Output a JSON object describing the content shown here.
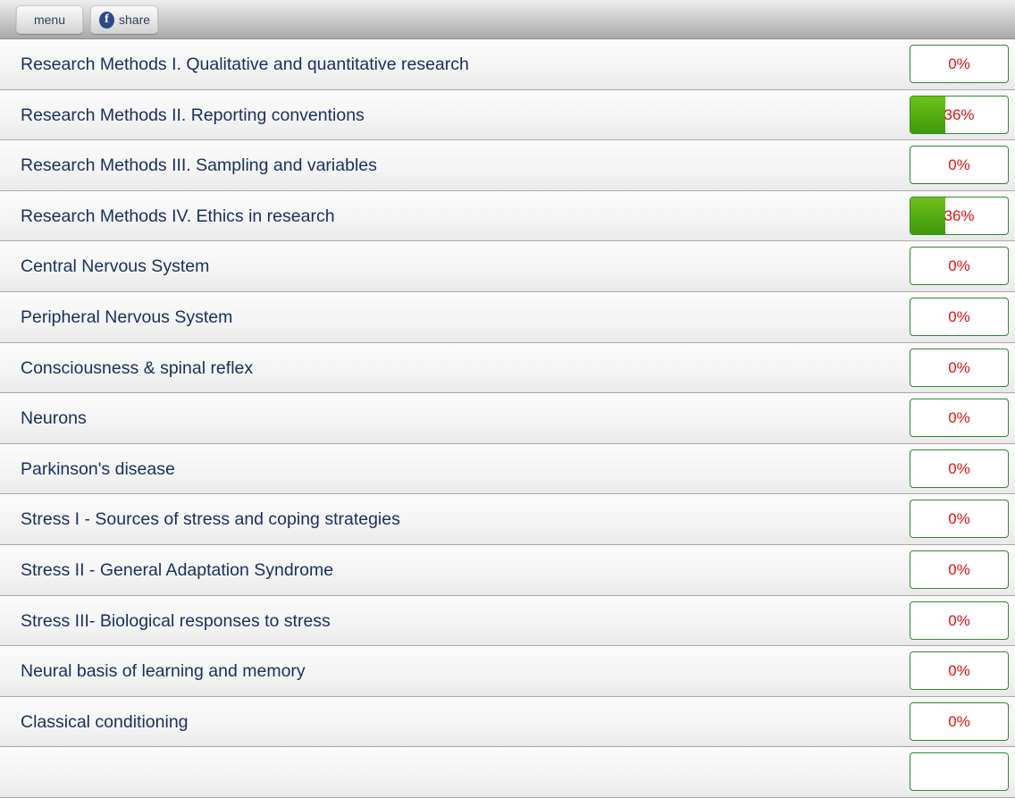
{
  "toolbar": {
    "menu_label": "menu",
    "share_label": "share",
    "share_icon": "facebook-icon",
    "fb_glyph": "f"
  },
  "colors": {
    "title_text": "#1a2f5e",
    "percent_text": "#e01010",
    "progress_border": "#2e8b2e",
    "progress_fill": "#4caf10"
  },
  "topics": [
    {
      "title": "Research Methods I. Qualitative and quantitative research",
      "progress_label": "0%",
      "progress": 0
    },
    {
      "title": "Research Methods II. Reporting conventions",
      "progress_label": "36%",
      "progress": 36
    },
    {
      "title": "Research Methods III. Sampling and variables",
      "progress_label": "0%",
      "progress": 0
    },
    {
      "title": "Research Methods IV. Ethics in research",
      "progress_label": "36%",
      "progress": 36
    },
    {
      "title": "Central Nervous System",
      "progress_label": "0%",
      "progress": 0
    },
    {
      "title": "Peripheral Nervous System",
      "progress_label": "0%",
      "progress": 0
    },
    {
      "title": "Consciousness & spinal reflex",
      "progress_label": "0%",
      "progress": 0
    },
    {
      "title": "Neurons",
      "progress_label": "0%",
      "progress": 0
    },
    {
      "title": "Parkinson's disease",
      "progress_label": "0%",
      "progress": 0
    },
    {
      "title": "Stress I - Sources of stress and coping strategies",
      "progress_label": "0%",
      "progress": 0
    },
    {
      "title": "Stress II - General Adaptation Syndrome",
      "progress_label": "0%",
      "progress": 0
    },
    {
      "title": "Stress III- Biological responses to stress",
      "progress_label": "0%",
      "progress": 0
    },
    {
      "title": "Neural basis of learning and memory",
      "progress_label": "0%",
      "progress": 0
    },
    {
      "title": "Classical conditioning",
      "progress_label": "0%",
      "progress": 0
    },
    {
      "title": "",
      "progress_label": "",
      "progress": 0
    }
  ]
}
